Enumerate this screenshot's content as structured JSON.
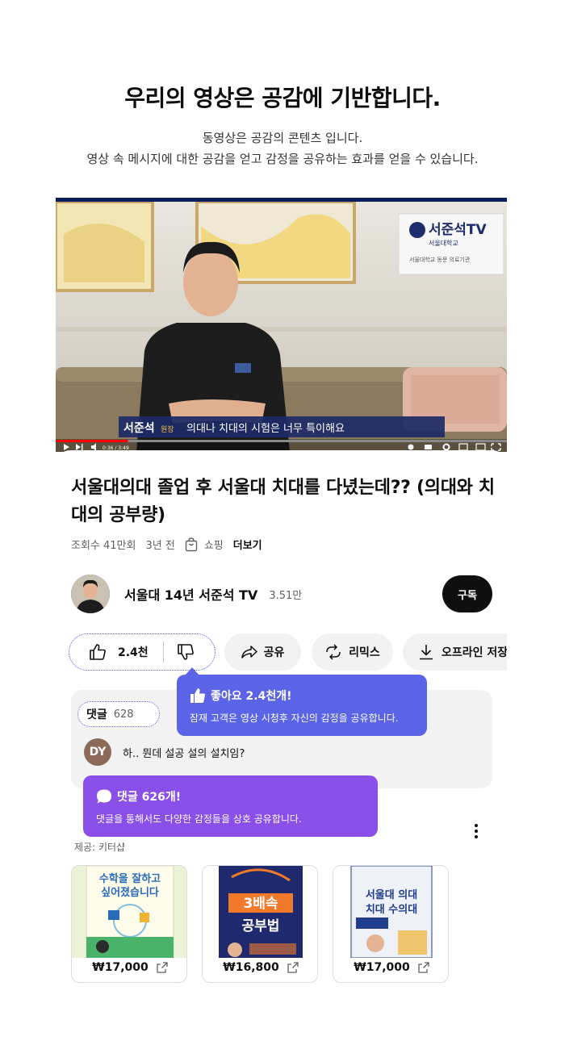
{
  "hero": {
    "title": "우리의 영상은 공감에 기반합니다.",
    "line1": "동영상은 공감의 콘텐츠 입니다.",
    "line2": "영상 속 메시지에 대한 공감을 얻고 감정을 공유하는 효과를 얻을 수 있습니다."
  },
  "video": {
    "logo_text": "서준석TV",
    "logo_sub": "서울대학교",
    "logo_caption": "서울대학교 동문 의료기관",
    "speaker_name": "서준석",
    "speaker_role": "원장",
    "caption": "의대나 치대의 시험은 너무 특이해요",
    "time": "0:36 / 3:49",
    "progress": 0.16,
    "title": "서울대의대 졸업 후 서울대 치대를 다녔는데?? (의대와 치대의 공부량)",
    "views": "조회수 41만회",
    "age": "3년 전",
    "shop_label": "쇼핑",
    "more_label": "더보기"
  },
  "channel": {
    "name": "서울대 14년 서준석 TV",
    "subs": "3.51만",
    "subscribe_label": "구독"
  },
  "actions": {
    "like_count": "2.4천",
    "share_label": "공유",
    "remix_label": "리믹스",
    "offline_label": "오프라인 저장"
  },
  "tooltip_like": {
    "title": "좋아요 2.4천개!",
    "desc": "잠재 고객은 영상 시청후 자신의 감정을 공유합니다.",
    "color": "#5b63e6"
  },
  "comments": {
    "label": "댓글",
    "count": "628",
    "avatar_initials": "DY",
    "text": "하.. 뭔데 설공 설의 설치임?"
  },
  "tooltip_comment": {
    "title": "댓글 626개!",
    "desc": "댓글을 통해서도 다양한 감정들을 상호 공유합니다.",
    "color": "#8a4fe8"
  },
  "shopping": {
    "provider": "제공: 키터샵",
    "products": [
      {
        "price": "₩17,000",
        "cover_line1": "수학을 잘하고",
        "cover_line2": "싶어졌습니다"
      },
      {
        "price": "₩16,800",
        "cover_line1": "3배속",
        "cover_line2": "공부법"
      },
      {
        "price": "₩17,000",
        "cover_line1": "서울대 의대",
        "cover_line2": "치대 수의대"
      }
    ]
  }
}
